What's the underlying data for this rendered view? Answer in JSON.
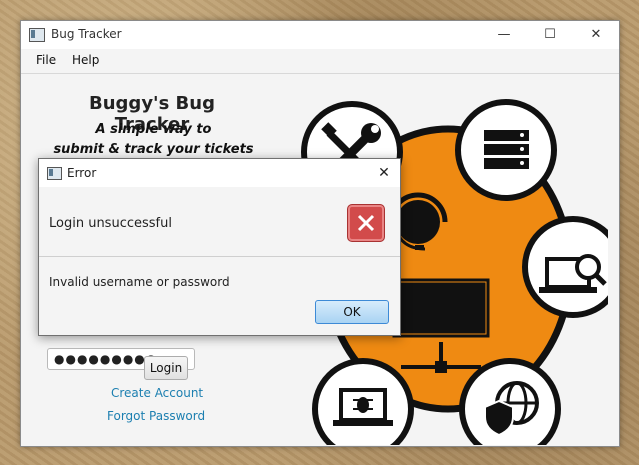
{
  "window": {
    "title": "Bug Tracker",
    "minimize": "—",
    "maximize": "☐",
    "close": "✕"
  },
  "menu": [
    "File",
    "Help"
  ],
  "app": {
    "title": "Buggy's Bug Tracker",
    "tagline_line1": "A simple way to",
    "tagline_line2": "submit & track your tickets"
  },
  "login": {
    "password_value": "●●●●●●●●●",
    "login_label": "Login",
    "create_account": "Create Account",
    "forgot_password": "Forgot Password"
  },
  "dialog": {
    "title": "Error",
    "close": "✕",
    "header": "Login unsuccessful",
    "content": "Invalid username or password",
    "ok_label": "OK"
  },
  "colors": {
    "accent_orange": "#ef8a12",
    "error_red": "#d24b4b",
    "link_blue": "#1c7fb0"
  },
  "icons": {
    "graphic_top_left": "tools-icon",
    "graphic_top_right": "server-rack-icon",
    "graphic_right": "laptop-search-icon",
    "graphic_bottom_left": "laptop-bug-icon",
    "graphic_bottom_right": "globe-shield-icon",
    "graphic_center": "support-agent-icon"
  }
}
